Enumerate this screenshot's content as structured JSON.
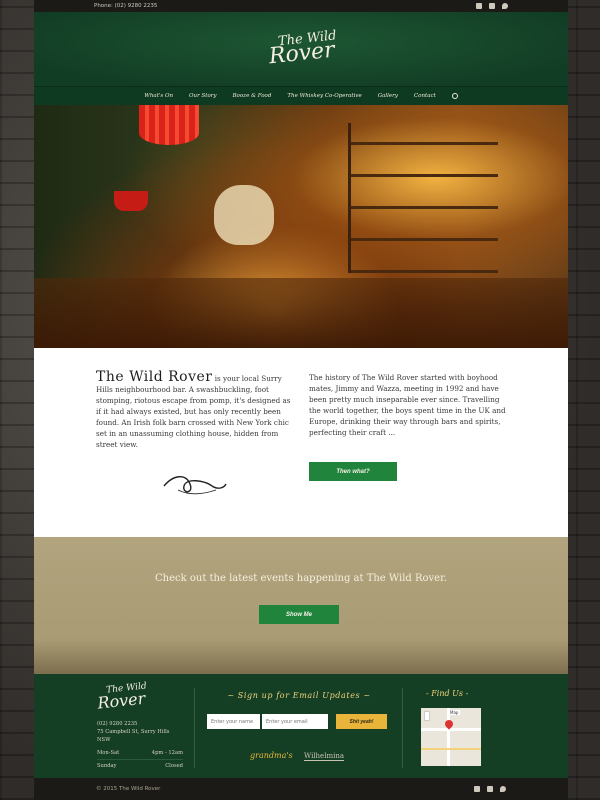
{
  "topbar": {
    "phone": "Phone: (02) 9280 2235"
  },
  "brand": {
    "line1": "The Wild",
    "line2": "Rover"
  },
  "nav": {
    "items": [
      "What's On",
      "Our Story",
      "Booze & Food",
      "The Whiskey Co-Operative",
      "Gallery",
      "Contact"
    ]
  },
  "intro": {
    "lead": "The Wild Rover",
    "lead_rest": " is your local Surry Hills neighbourhood bar. A swashbuckling, foot stomping, riotous escape from pomp, it's designed as if it had always existed, but has only recently been found. An Irish folk barn crossed with New York chic set in an unassuming clothing house, hidden from street view.",
    "story": "The history of The Wild Rover started with boyhood mates, Jimmy and Wazza, meeting in 1992 and have been pretty much inseparable ever since. Travelling the world together, the boys spent time in the UK and Europe, drinking their way through bars and spirits, perfecting their craft ...",
    "button": "Then what?"
  },
  "events": {
    "text": "Check out the latest events happening at The Wild Rover.",
    "button": "Show Me"
  },
  "footer": {
    "phone": "(02) 9280 2235",
    "address": "75 Campbell St, Surry Hills NSW",
    "hours": [
      {
        "day": "Mon-Sat",
        "time": "4pm - 12am"
      },
      {
        "day": "Sunday",
        "time": "Closed"
      }
    ],
    "signup_title": "~ Sign up for Email Updates ~",
    "name_placeholder": "Enter your name",
    "email_placeholder": "Enter your email",
    "signup_button": "Shit yeah!",
    "partner1": "grandma's",
    "partner2": "Wilhelmina",
    "find_title": "- Find Us -",
    "map_label": "Map"
  },
  "bottom": {
    "copyright": "© 2015 The Wild Rover"
  },
  "colors": {
    "green_dark": "#143f24",
    "green_button": "#21843d",
    "gold": "#e8b53a",
    "tan": "#ada07a"
  }
}
